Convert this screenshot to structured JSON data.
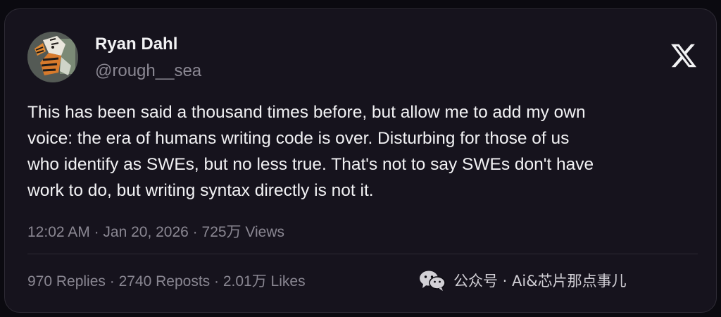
{
  "author": {
    "name": "Ryan Dahl",
    "handle": "@rough__sea",
    "avatar": "avatar-image"
  },
  "brand_icon": "x-logo-icon",
  "tweet": {
    "lines": [
      "This has been said a thousand times before, but allow me to add my own",
      "voice: the era of humans writing code is over. Disturbing for those of us",
      "who identify as SWEs, but no less true. That's not to say SWEs don't have",
      "work to do, but writing syntax directly is not it."
    ]
  },
  "meta": {
    "time": "12:02 AM",
    "date": "Jan 20, 2026",
    "views": "725万 Views",
    "separator": " · "
  },
  "stats": {
    "replies": "970 Replies",
    "reposts": "2740 Reposts",
    "likes": "2.01万 Likes",
    "separator": " · "
  },
  "watermark": {
    "icon": "wechat-icon",
    "text": "公众号 · Ai&芯片那点事儿"
  },
  "colors": {
    "background": "#16131d",
    "border": "#2e2b35",
    "primary_text": "#f2f2f4",
    "secondary_text": "#8a8792"
  }
}
